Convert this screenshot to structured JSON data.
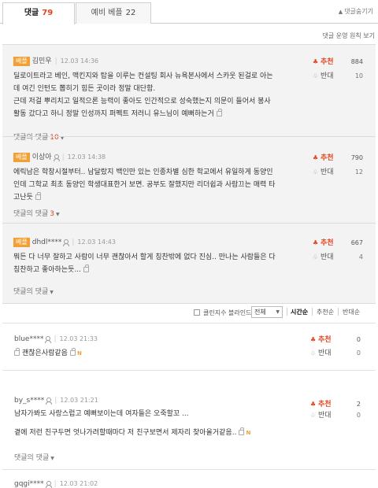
{
  "tabs": [
    {
      "label": "댓글",
      "count": "79"
    },
    {
      "label": "예비 베플",
      "count": "22"
    }
  ],
  "hide_comments": "댓글숨기기",
  "policy_link": "댓글 운영 원칙 보기",
  "best_badge": "베플",
  "vote_up_label": "추천",
  "vote_down_label": "반대",
  "best_comments": [
    {
      "user": "김민우",
      "date": "12.03 14:36",
      "lines": [
        "딜로이트라고 베인, 맥킨지와 탑을 이루는 컨설팅 회사 뉴욕본사에서 스카웃 된걸로 아는",
        "데 여긴 인턴도 뽑히기 힘든 곳이라 정말 대단함.",
        "근데 저걸 뿌리치고 일적으론 능력이 좋아도 인간적으로 성숙했는지 의문이 들어서 봉사",
        "활동 갔다고 하니 정말 인성까지 퍼펙트 저러니 유느님이 예뻐하는거"
      ],
      "reply_label": "댓글의 댓글",
      "reply_count": "10",
      "up": "884",
      "down": "10"
    },
    {
      "user": "이상아",
      "date": "12.03 14:38",
      "lines": [
        "에릭남은 학창시절부터.. 남달랐지 백인만 있는 인종차별 심한 학교에서 유일하게 동양인",
        "인데 그학교 최초 동양인 학생대표한거 보면. 공부도 잘했지만 리더쉽과 사람끄는 매력 타",
        "고난듯"
      ],
      "reply_label": "댓글의 댓글",
      "reply_count": "3",
      "up": "790",
      "down": "12"
    },
    {
      "user": "dhdl****",
      "date": "12.03 14:43",
      "lines": [
        "뭐든 다 너무 잘하고 사람이 너무 괜찮아서 할게 칭찬밖에 없다 진심.. 만나는 사람들은 다",
        "칭찬하고 좋아하는듯..."
      ],
      "reply_label": "댓글의 댓글",
      "reply_count": "",
      "up": "667",
      "down": "4"
    }
  ],
  "sortbar": {
    "clean_bot": "클린지수 블라인드",
    "filter": "전체",
    "sort_options": [
      "시간순",
      "추천순",
      "반대순"
    ]
  },
  "comments": [
    {
      "user": "blue****",
      "date": "12.03 21:33",
      "lines": [
        "괜찮은사람같음"
      ],
      "reply_label": "",
      "up": "0",
      "down": "0"
    },
    {
      "user": "by_s****",
      "date": "12.03 21:21",
      "lines": [
        "남자가봐도 사랑스럽고 예뻐보이는데 여자들은 오죽할꼬 ...",
        "",
        "곁에 저런 친구두면 엇나가려할때마다 저 친구보면서 제자리 찾아올거같음.."
      ],
      "reply_label": "댓글의 댓글",
      "up": "2",
      "down": "0"
    },
    {
      "user": "gqgi****",
      "date": "12.03 21:02",
      "lines": [],
      "reply_label": "",
      "up": "",
      "down": ""
    }
  ]
}
